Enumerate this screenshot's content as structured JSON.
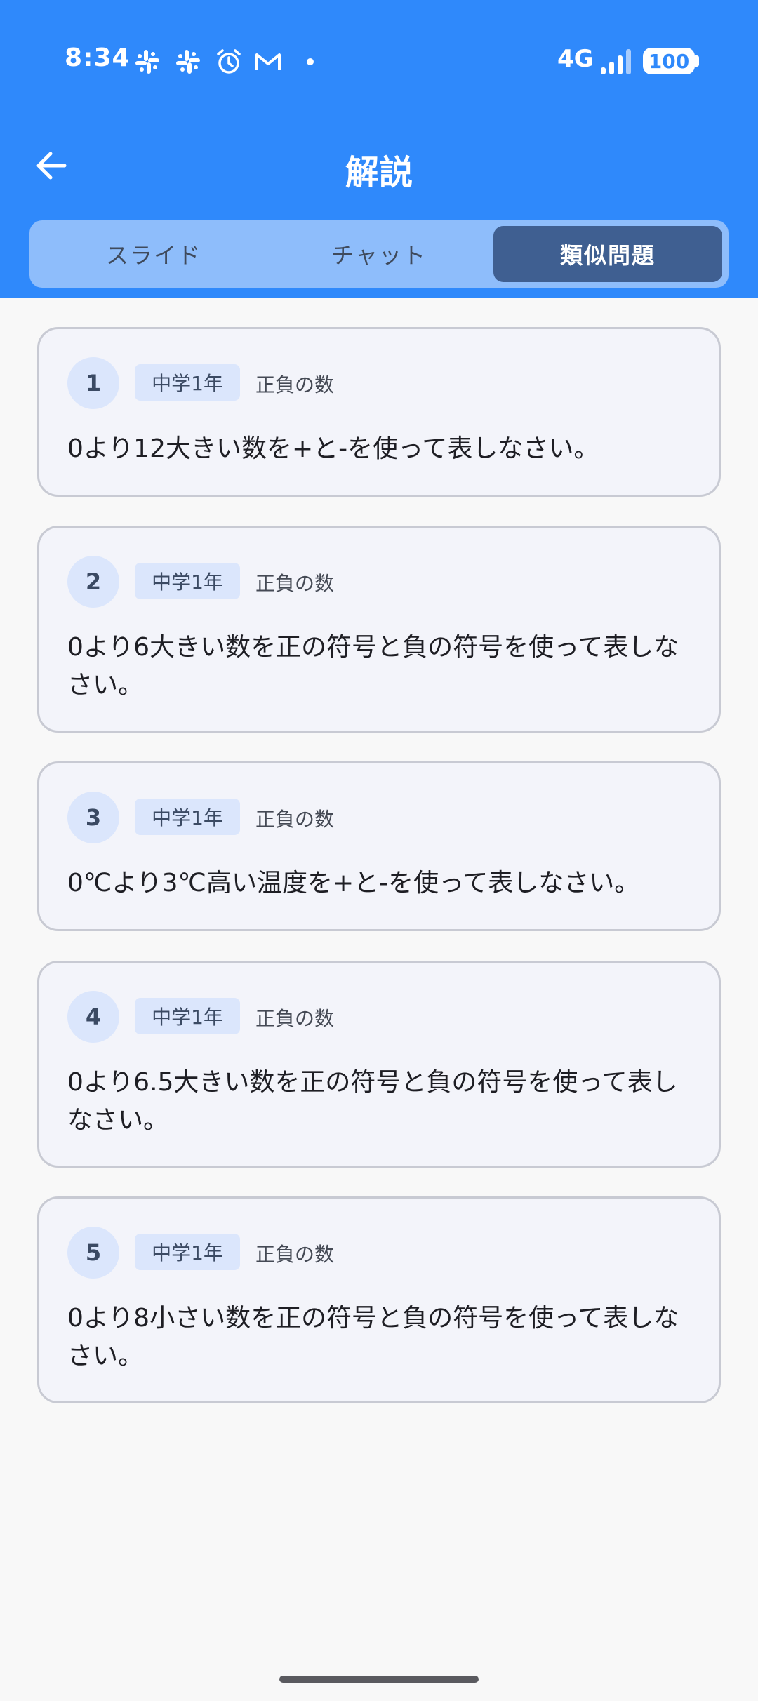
{
  "status_bar": {
    "time": "8:34",
    "network": "4G",
    "battery": "100",
    "icons": [
      "slack-icon",
      "slack-icon",
      "alarm-icon",
      "gmail-icon",
      "dot-icon",
      "signal-icon",
      "battery-icon"
    ]
  },
  "app_bar": {
    "title": "解説",
    "back_icon": "arrow-left-icon"
  },
  "tabs": [
    {
      "label": "スライド",
      "active": false
    },
    {
      "label": "チャット",
      "active": false
    },
    {
      "label": "類似問題",
      "active": true
    }
  ],
  "problems": [
    {
      "number": "1",
      "grade": "中学1年",
      "topic": "正負の数",
      "text": "0より12大きい数を+と-を使って表しなさい。"
    },
    {
      "number": "2",
      "grade": "中学1年",
      "topic": "正負の数",
      "text": "0より6大きい数を正の符号と負の符号を使って表しなさい。"
    },
    {
      "number": "3",
      "grade": "中学1年",
      "topic": "正負の数",
      "text": "0℃より3℃高い温度を+と-を使って表しなさい。"
    },
    {
      "number": "4",
      "grade": "中学1年",
      "topic": "正負の数",
      "text": "0より6.5大きい数を正の符号と負の符号を使って表しなさい。"
    },
    {
      "number": "5",
      "grade": "中学1年",
      "topic": "正負の数",
      "text": "0より8小さい数を正の符号と負の符号を使って表しなさい。"
    }
  ],
  "colors": {
    "header_bg": "#2f89fb",
    "tab_bar_bg": "#8ebdfb",
    "active_tab_bg": "#3f5f91",
    "card_bg": "#f3f4fa",
    "badge_bg": "#dbe6fc"
  }
}
